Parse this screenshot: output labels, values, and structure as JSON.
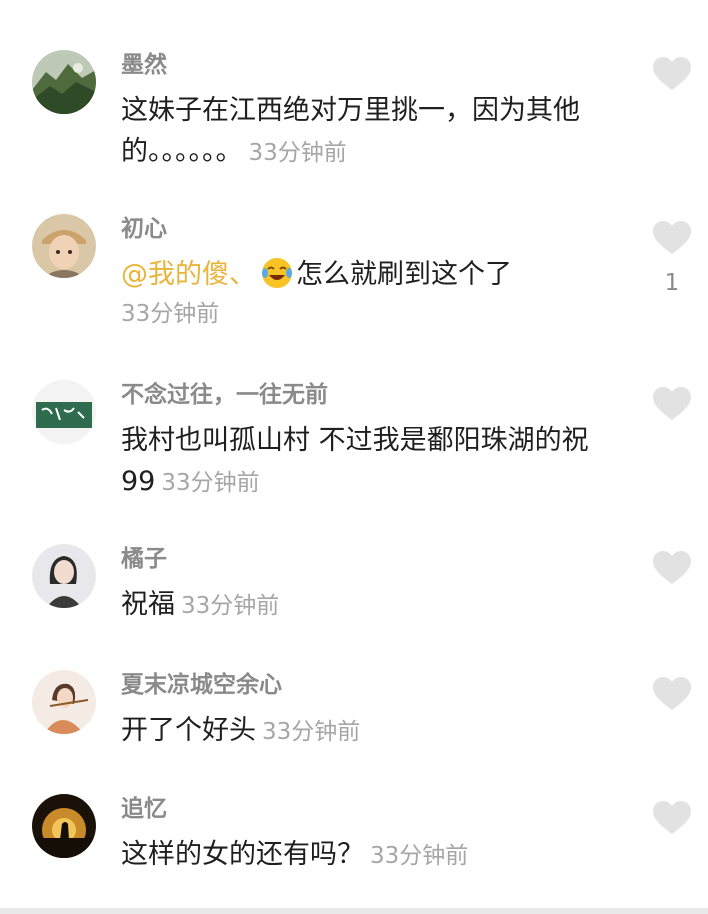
{
  "colors": {
    "name": "#8a8a8a",
    "text": "#1f1f1f",
    "time": "#a6a6a6",
    "mention": "#e8b53a",
    "like_icon": "#e2e2e2"
  },
  "comments": [
    {
      "username": "墨然",
      "text": "这妹子在江西绝对万里挑一，因为其他的。。。。。。",
      "time": "33分钟前",
      "avatar_icon": "mountain-landscape-avatar",
      "like_icon": "heart-icon"
    },
    {
      "username": "初心",
      "mention": "@我的傻、",
      "emoji_icon": "laughing-crying-emoji-icon",
      "text": "怎么就刷到这个了",
      "time": "33分钟前",
      "likes": "1",
      "avatar_icon": "person-cap-avatar",
      "like_icon": "heart-icon"
    },
    {
      "username": "不念过往，一往无前",
      "text": "我村也叫孤山村 不过我是鄱阳珠湖的祝99",
      "time": "33分钟前",
      "avatar_icon": "green-calligraphy-avatar",
      "like_icon": "heart-icon"
    },
    {
      "username": "橘子",
      "text": "祝福",
      "time": "33分钟前",
      "avatar_icon": "woman-portrait-avatar",
      "like_icon": "heart-icon"
    },
    {
      "username": "夏末凉城空余心",
      "text": "开了个好头",
      "time": "33分钟前",
      "avatar_icon": "flute-player-avatar",
      "like_icon": "heart-icon"
    },
    {
      "username": "追忆",
      "text": "这样的女的还有吗？",
      "time": "33分钟前",
      "avatar_icon": "sunset-silhouette-avatar",
      "like_icon": "heart-icon"
    }
  ]
}
